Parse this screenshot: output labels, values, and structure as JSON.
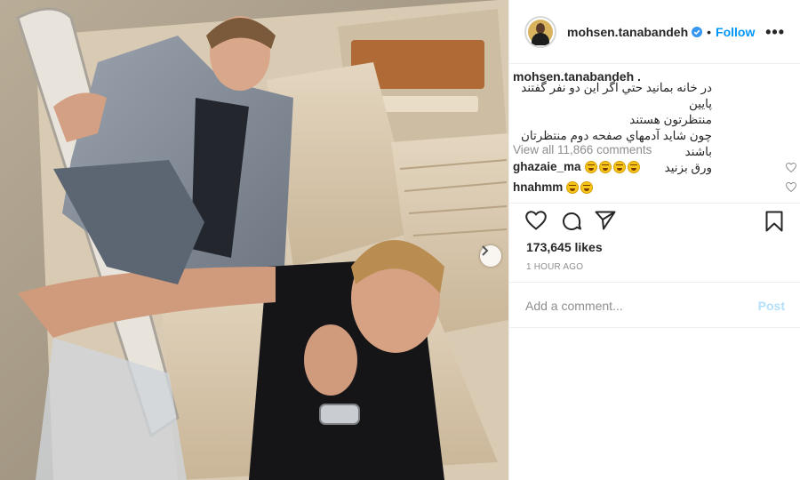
{
  "post": {
    "username": "mohsen.tanabandeh",
    "follow_label": "Follow",
    "more_label": "•••",
    "separator": "•",
    "caption_user": "mohsen.tanabandeh .",
    "caption_lines": [
      "در خانه بمانيد حتي اگر اين دو نفر گفتند پايين",
      "منتظرتون هستند",
      "چون شايد آدمهاي صفحه دوم منتظرتان باشند",
      "ورق بزنيد"
    ],
    "view_all_comments": "View all 11,866 comments",
    "comments": [
      {
        "user": "ghazaie_ma",
        "emoji_count": 4,
        "emoji": "grinning-sweat"
      },
      {
        "user": "hnahmm",
        "emoji_count": 2,
        "emoji": "grinning-sweat"
      }
    ],
    "likes": "173,645 likes",
    "time_ago": "1 HOUR AGO"
  },
  "composer": {
    "placeholder": "Add a comment...",
    "post_label": "Post"
  },
  "icons": {
    "verified": "verified-badge-icon",
    "like": "heart-icon",
    "comment": "comment-bubble-icon",
    "share": "paper-plane-icon",
    "save": "bookmark-icon",
    "next": "chevron-right-icon"
  },
  "colors": {
    "link_blue": "#0095f6",
    "post_disabled": "#b2dffc",
    "muted": "#8e8e8e",
    "text": "#262626"
  }
}
